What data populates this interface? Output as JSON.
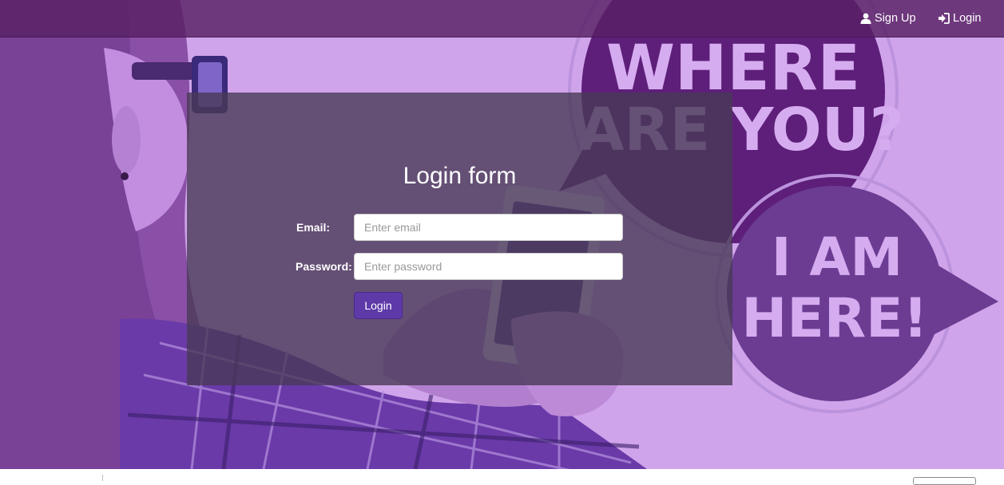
{
  "navbar": {
    "signup": {
      "label": "Sign Up",
      "icon": "user-icon"
    },
    "login": {
      "label": "Login",
      "icon": "log-in-icon"
    }
  },
  "hero": {
    "bubble_top_lines": [
      "WHERE",
      "ARE YOU?"
    ],
    "bubble_bottom_lines": [
      "I AM",
      "HERE!"
    ]
  },
  "login_form": {
    "title": "Login form",
    "email": {
      "label": "Email:",
      "placeholder": "Enter email",
      "value": ""
    },
    "password": {
      "label": "Password:",
      "placeholder": "Enter password",
      "value": ""
    },
    "submit_label": "Login"
  },
  "colors": {
    "background": "#d0a4ea",
    "navbar": "#582064",
    "panel": "#483a58",
    "button": "#5e3aa8",
    "bubble_dark": "#5e1f7a",
    "bubble_light": "#6b3c92",
    "bubble_text": "#d6acf0"
  }
}
